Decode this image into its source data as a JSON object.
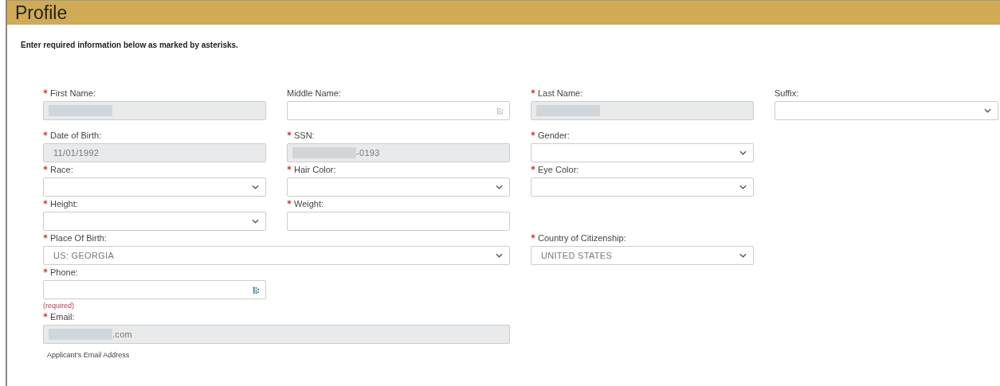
{
  "header": {
    "title": "Profile"
  },
  "instructions": "Enter required information below as marked by asterisks.",
  "fields": [
    {
      "label": "First Name:",
      "required": true,
      "kind": "text",
      "disabled": true,
      "masked": true
    },
    {
      "label": "Middle Name:",
      "required": false,
      "kind": "text",
      "disabled": false,
      "keypad": true,
      "keypad_highlighted": false
    },
    {
      "label": "Last Name:",
      "required": true,
      "kind": "text",
      "disabled": true,
      "masked": true
    },
    {
      "label": "Suffix:",
      "required": false,
      "kind": "select",
      "disabled": false
    },
    {
      "label": "Date of Birth:",
      "required": true,
      "kind": "text",
      "disabled": true,
      "value": "11/01/1992"
    },
    {
      "label": "SSN:",
      "required": true,
      "kind": "text",
      "disabled": true,
      "masked": true,
      "value": "-0193"
    },
    {
      "label": "Gender:",
      "required": true,
      "kind": "select",
      "disabled": false
    },
    {
      "label": "Race:",
      "required": true,
      "kind": "select",
      "disabled": false
    },
    {
      "label": "Hair Color:",
      "required": true,
      "kind": "select",
      "disabled": false
    },
    {
      "label": "Eye Color:",
      "required": true,
      "kind": "select",
      "disabled": false
    },
    {
      "label": "Height:",
      "required": true,
      "kind": "select",
      "disabled": false
    },
    {
      "label": "Weight:",
      "required": true,
      "kind": "text",
      "disabled": false
    },
    {
      "label": "Place Of Birth:",
      "required": true,
      "kind": "select",
      "disabled": false,
      "value": "US: GEORGIA"
    },
    {
      "label": "Country of Citizenship:",
      "required": true,
      "kind": "select",
      "disabled": false,
      "value": "UNITED STATES"
    },
    {
      "label": "Phone:",
      "required": true,
      "kind": "text",
      "disabled": false,
      "keypad": true,
      "keypad_highlighted": true,
      "error": "(required)"
    },
    {
      "label": "Email:",
      "required": true,
      "kind": "text",
      "disabled": true,
      "masked": true,
      "value": ".com",
      "help": "Applicant's Email Address"
    }
  ]
}
